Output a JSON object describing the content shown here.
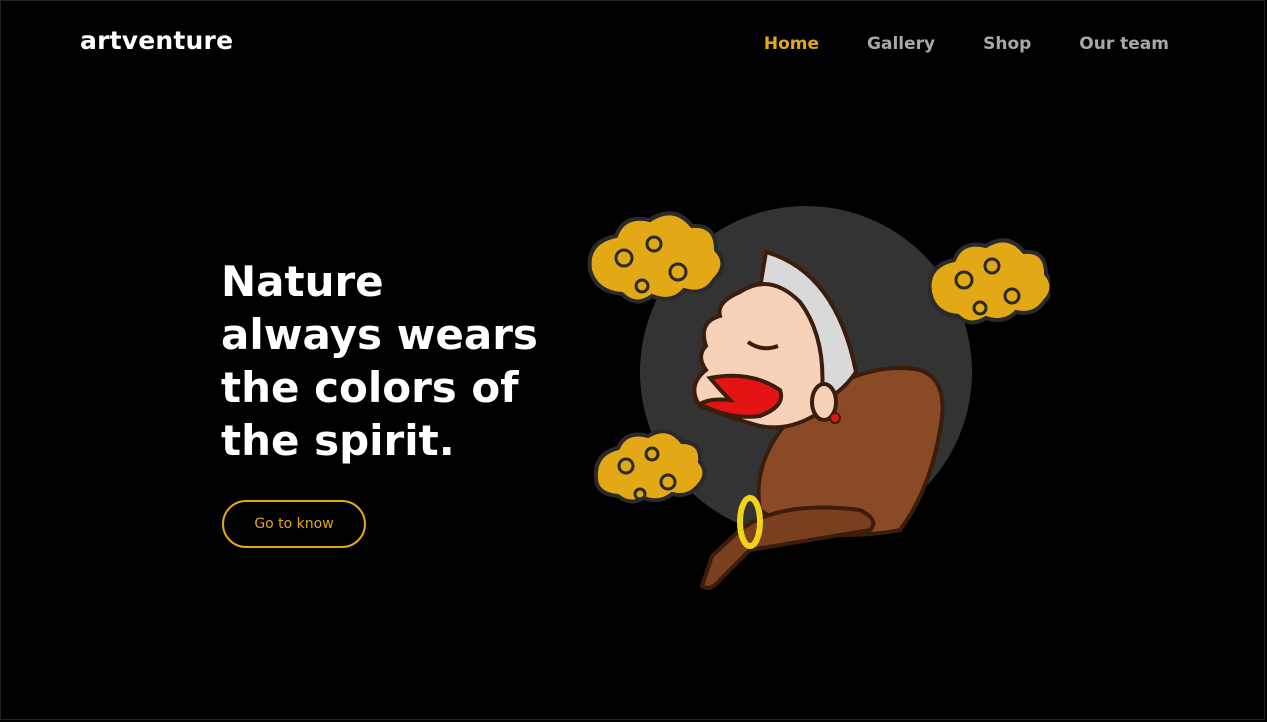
{
  "brand": {
    "name": "artventure"
  },
  "nav": {
    "items": [
      {
        "label": "Home",
        "active": true
      },
      {
        "label": "Gallery",
        "active": false
      },
      {
        "label": "Shop",
        "active": false
      },
      {
        "label": "Our team",
        "active": false
      }
    ]
  },
  "hero": {
    "headline": "Nature always wears the colors of the spirit.",
    "cta_label": "Go to know",
    "illustration": "wayang-figure-with-golden-clouds"
  },
  "colors": {
    "background": "#000000",
    "accent": "#e3a816",
    "nav_inactive": "#a8a8a8",
    "text": "#ffffff"
  }
}
